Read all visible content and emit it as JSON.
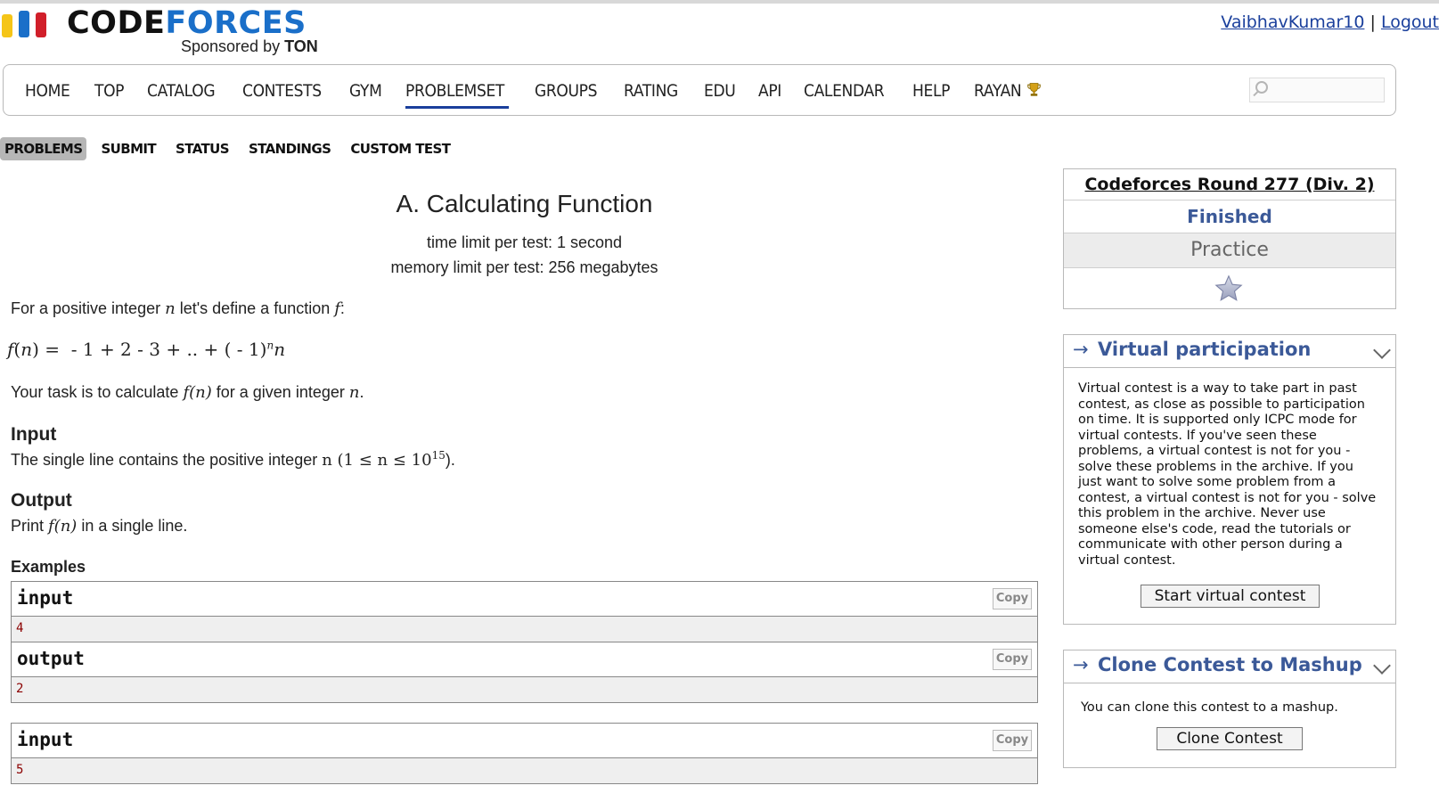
{
  "header": {
    "logo_code": "CODE",
    "logo_forces": "FORCES",
    "sponsor_prefix": "Sponsored by ",
    "sponsor_name": "TON",
    "username": "VaibhavKumar10",
    "separator": "|",
    "logout": "Logout"
  },
  "nav": {
    "items": [
      "HOME",
      "TOP",
      "CATALOG",
      "CONTESTS",
      "GYM",
      "PROBLEMSET",
      "GROUPS",
      "RATING",
      "EDU",
      "API",
      "CALENDAR",
      "HELP",
      "RAYAN"
    ],
    "active": "PROBLEMSET",
    "search_placeholder": ""
  },
  "subnav": {
    "items": [
      "PROBLEMS",
      "SUBMIT",
      "STATUS",
      "STANDINGS",
      "CUSTOM TEST"
    ],
    "active": "PROBLEMS"
  },
  "problem": {
    "title": "A. Calculating Function",
    "time_limit": "time limit per test: 1 second",
    "memory_limit": "memory limit per test: 256 megabytes",
    "statement_prefix": "For a positive integer ",
    "statement_mid": " let's define a function ",
    "statement_var_n": "n",
    "statement_var_f": "f",
    "statement_suffix": ":",
    "formula": "f(n) = - 1 + 2 - 3 + .. + ( - 1)ⁿn",
    "task_prefix": "Your task is to calculate ",
    "task_func": "f(n)",
    "task_mid": " for a given integer ",
    "task_var": "n",
    "task_suffix": ".",
    "input_title": "Input",
    "input_text_prefix": "The single line contains the positive integer ",
    "input_constraint": "n (1 ≤ n ≤ 10",
    "input_exponent": "15",
    "input_text_suffix": ").",
    "output_title": "Output",
    "output_prefix": "Print ",
    "output_func": "f(n)",
    "output_suffix": " in a single line.",
    "examples_title": "Examples"
  },
  "examples": [
    {
      "label": "input",
      "value": "4",
      "copy": "Copy"
    },
    {
      "label": "output",
      "value": "2",
      "copy": "Copy"
    },
    {
      "label": "input",
      "value": "5",
      "copy": "Copy"
    }
  ],
  "sidebar": {
    "contest_name": "Codeforces Round 277 (Div. 2)",
    "status": "Finished",
    "mode": "Practice",
    "virtual": {
      "arrow": "→",
      "title": "Virtual participation",
      "text": "Virtual contest is a way to take part in past contest, as close as possible to participation on time. It is supported only ICPC mode for virtual contests. If you've seen these problems, a virtual contest is not for you - solve these problems in the archive. If you just want to solve some problem from a contest, a virtual contest is not for you - solve this problem in the archive. Never use someone else's code, read the tutorials or communicate with other person during a virtual contest.",
      "button": "Start virtual contest"
    },
    "clone": {
      "arrow": "→",
      "title": "Clone Contest to Mashup",
      "text": "You can clone this contest to a mashup.",
      "button": "Clone Contest"
    }
  },
  "colors": {
    "link_blue": "#1a3f9c",
    "box_title_blue": "#3b5998",
    "sample_value_red": "#8b0000",
    "logo_yellow": "#f5c518",
    "logo_blue": "#1a6fc9",
    "logo_red": "#d11f2a"
  }
}
